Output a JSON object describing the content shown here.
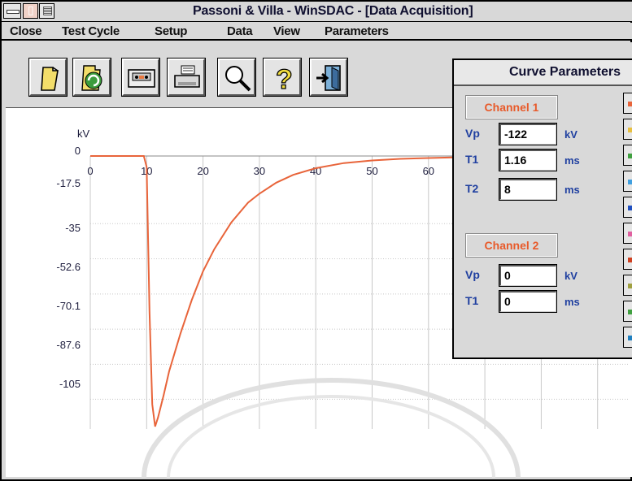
{
  "window": {
    "title": "Passoni & Villa - WinSDAC - [Data Acquisition]"
  },
  "menu": [
    {
      "label": "Close"
    },
    {
      "label": "Test Cycle"
    },
    {
      "label": "Setup"
    },
    {
      "label": "Data"
    },
    {
      "label": "View"
    },
    {
      "label": "Parameters"
    }
  ],
  "toolbar": {
    "buttons": [
      {
        "icon": "open-file-icon"
      },
      {
        "icon": "refresh-icon"
      },
      {
        "icon": "tape-icon"
      },
      {
        "icon": "printer-icon"
      },
      {
        "icon": "magnifier-icon"
      },
      {
        "icon": "help-icon"
      },
      {
        "icon": "exit-icon"
      }
    ]
  },
  "plot": {
    "y_unit": "kV",
    "y_ticks": [
      "0",
      "-17.5",
      "-35",
      "-52.6",
      "-70.1",
      "-87.6",
      "-105"
    ],
    "x_ticks": [
      "0",
      "10",
      "20",
      "30",
      "40",
      "50",
      "60"
    ],
    "trace_color": "#e8643a"
  },
  "chart_data": {
    "type": "line",
    "title": "",
    "xlabel": "",
    "ylabel": "kV",
    "xlim": [
      0,
      70
    ],
    "ylim": [
      -122,
      0
    ],
    "series": [
      {
        "x": [
          0,
          9.5,
          10,
          10.5,
          11,
          11.5,
          12,
          13,
          14,
          16,
          18,
          20,
          22,
          25,
          28,
          30,
          33,
          36,
          40,
          45,
          50,
          55,
          60,
          65,
          70
        ],
        "values": [
          0,
          0,
          -5,
          -70,
          -112,
          -122,
          -118,
          -108,
          -97,
          -80,
          -65,
          -52,
          -42,
          -30,
          -21,
          -17,
          -12,
          -8.5,
          -5.5,
          -3.2,
          -2,
          -1.3,
          -0.9,
          -0.6,
          -0.4
        ]
      }
    ]
  },
  "panel": {
    "title": "Curve Parameters",
    "channel1": {
      "label": "Channel 1",
      "params": [
        {
          "name": "Vp",
          "value": "-122",
          "unit": "kV"
        },
        {
          "name": "T1",
          "value": "1.16",
          "unit": "ms"
        },
        {
          "name": "T2",
          "value": "8",
          "unit": "ms"
        }
      ]
    },
    "channel2": {
      "label": "Channel 2",
      "params": [
        {
          "name": "Vp",
          "value": "0",
          "unit": "kV"
        },
        {
          "name": "T1",
          "value": "0",
          "unit": "ms"
        }
      ]
    },
    "swatches": [
      "#e8643a",
      "#e8c040",
      "#40a040",
      "#40a0e0",
      "#2050c0",
      "#e060a0",
      "#d04020",
      "#a0a040",
      "#40a040",
      "#2080c0"
    ]
  }
}
